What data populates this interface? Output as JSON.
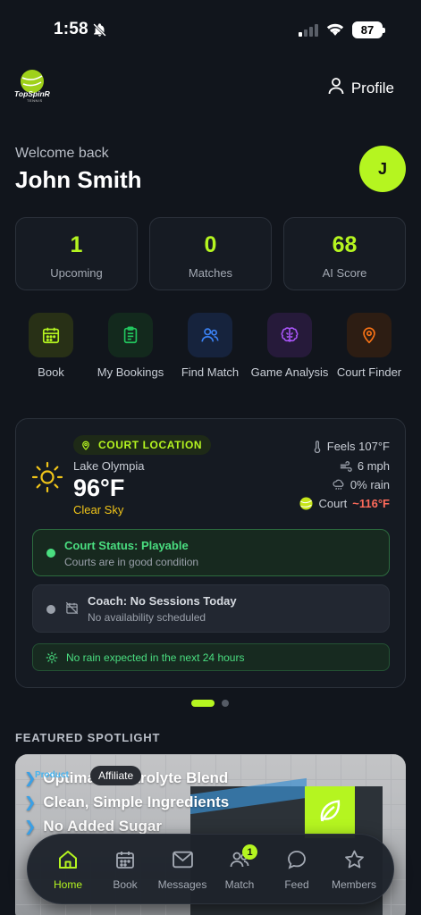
{
  "status_bar": {
    "time": "1:58",
    "battery": "87"
  },
  "header": {
    "logo_text": "TopSpinR",
    "logo_sub": "TENNIS",
    "profile_label": "Profile"
  },
  "welcome": {
    "subtitle": "Welcome back",
    "name": "John Smith",
    "avatar_initial": "J"
  },
  "stats": [
    {
      "value": "1",
      "label": "Upcoming"
    },
    {
      "value": "0",
      "label": "Matches"
    },
    {
      "value": "68",
      "label": "AI Score"
    }
  ],
  "quick_actions": [
    {
      "label": "Book",
      "icon": "calendar-icon",
      "color": "#b5f520"
    },
    {
      "label": "My Bookings",
      "icon": "clipboard-icon",
      "color": "#22c55e"
    },
    {
      "label": "Find Match",
      "icon": "users-icon",
      "color": "#3b82f6"
    },
    {
      "label": "Game Analysis",
      "icon": "brain-icon",
      "color": "#a855f7"
    },
    {
      "label": "Court Finder",
      "icon": "map-pin-icon",
      "color": "#f97316"
    }
  ],
  "weather": {
    "badge": "COURT LOCATION",
    "location": "Lake Olympia",
    "temp": "96°F",
    "condition": "Clear Sky",
    "feels": "Feels 107°F",
    "wind": "6 mph",
    "rain": "0% rain",
    "court_label": "Court",
    "court_temp": "~116°F",
    "court_status_title": "Court Status: Playable",
    "court_status_sub": "Courts are in good condition",
    "coach_title": "Coach: No Sessions Today",
    "coach_sub": "No availability scheduled",
    "rain_note": "No rain expected in the next 24 hours"
  },
  "featured": {
    "heading": "FEATURED SPOTLIGHT",
    "product_tag": "Product",
    "affiliate_tag": "Affiliate",
    "lines": [
      "Optimal Electrolyte Blend",
      "Clean, Simple Ingredients",
      "No Added Sugar"
    ]
  },
  "bottom_nav": {
    "items": [
      {
        "label": "Home",
        "icon": "home-icon"
      },
      {
        "label": "Book",
        "icon": "calendar-icon"
      },
      {
        "label": "Messages",
        "icon": "mail-icon"
      },
      {
        "label": "Match",
        "icon": "users-icon",
        "badge": "1"
      },
      {
        "label": "Feed",
        "icon": "chat-bubble-icon"
      },
      {
        "label": "Members",
        "icon": "star-icon"
      }
    ],
    "active": "Home"
  },
  "colors": {
    "accent": "#b5f520",
    "background": "#11151c",
    "card": "#151a22",
    "court_temp": "#ff6b5b",
    "condition": "#f0c419"
  }
}
